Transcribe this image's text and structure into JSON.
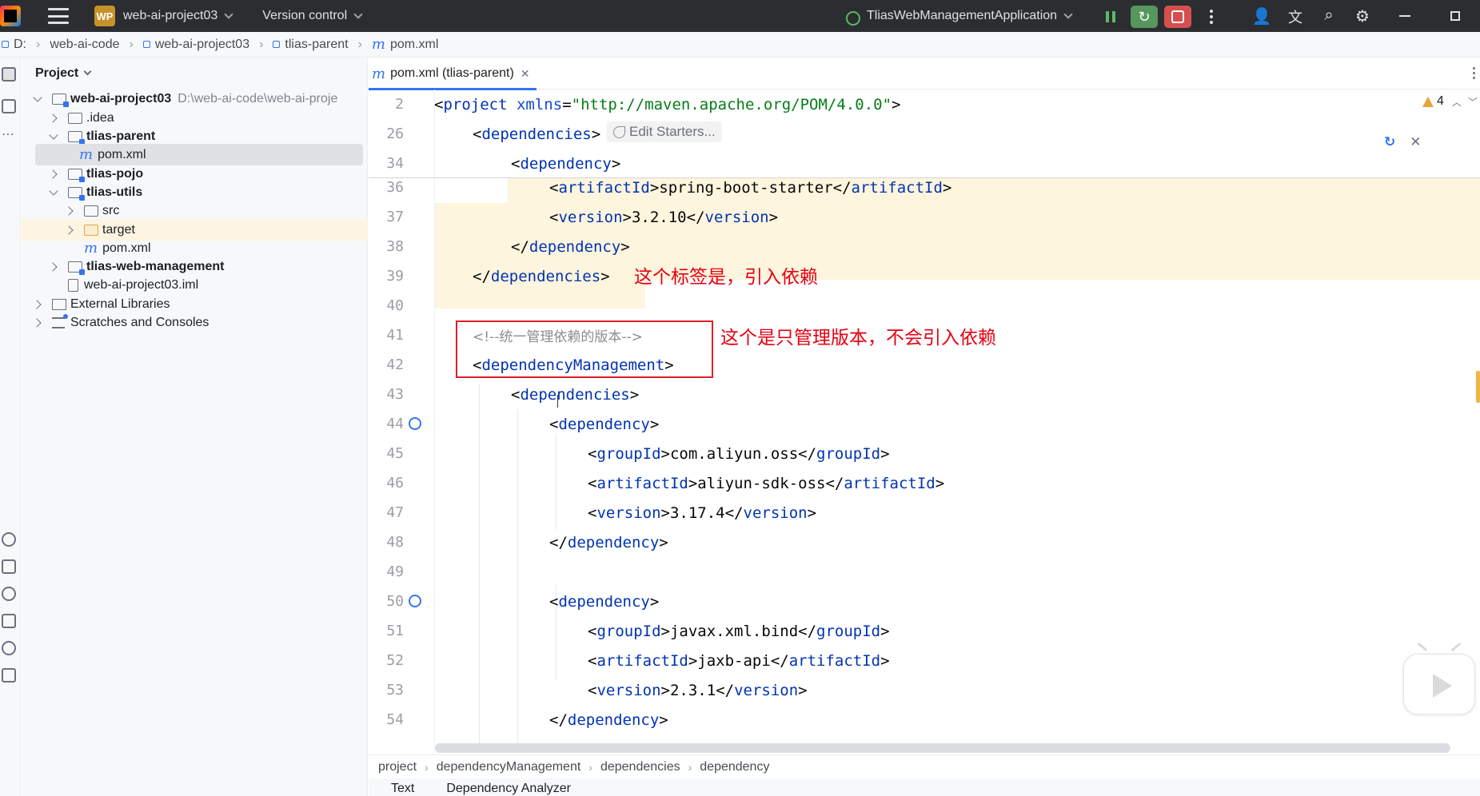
{
  "titlebar": {
    "project_badge": "WP",
    "project_name": "web-ai-project03",
    "version_control": "Version control",
    "run_config": "TliasWebManagementApplication"
  },
  "breadcrumb": [
    "D:",
    "web-ai-code",
    "web-ai-project03",
    "tlias-parent",
    "pom.xml"
  ],
  "project_panel": {
    "title": "Project",
    "tree": [
      {
        "label": "web-ai-project03",
        "hint": "D:\\web-ai-code\\web-ai-proje"
      },
      {
        "label": ".idea"
      },
      {
        "label": "tlias-parent"
      },
      {
        "label": "pom.xml"
      },
      {
        "label": "tlias-pojo"
      },
      {
        "label": "tlias-utils"
      },
      {
        "label": "src"
      },
      {
        "label": "target"
      },
      {
        "label": "pom.xml"
      },
      {
        "label": "tlias-web-management"
      },
      {
        "label": "web-ai-project03.iml"
      },
      {
        "label": "External Libraries"
      },
      {
        "label": "Scratches and Consoles"
      }
    ]
  },
  "editor": {
    "tab_label": "pom.xml (tlias-parent)",
    "warning_count": "4",
    "edit_starters": "Edit Starters...",
    "line_numbers": [
      "2",
      "26",
      "34",
      "36",
      "37",
      "38",
      "39",
      "40",
      "41",
      "42",
      "43",
      "44",
      "45",
      "46",
      "47",
      "48",
      "49",
      "50",
      "51",
      "52",
      "53",
      "54"
    ],
    "code": {
      "l2_tag": "project",
      "l2_attr": "xmlns",
      "l2_value": "\"http://maven.apache.org/POM/4.0.0\"",
      "dependencies": "dependencies",
      "dependency": "dependency",
      "artifactId": "artifactId",
      "groupId": "groupId",
      "version": "version",
      "dependencyManagement": "dependencyManagement",
      "l36_text": "spring-boot-starter",
      "l37_text": "3.2.10",
      "l41_comment": "<!--统一管理依赖的版本-->",
      "l45_text": "com.aliyun.oss",
      "l46_text": "aliyun-sdk-oss",
      "l47_text": "3.17.4",
      "l51_text": "javax.xml.bind",
      "l52_text": "jaxb-api",
      "l53_text": "2.3.1"
    }
  },
  "annotations": {
    "dependencies_note": "这个标签是，引入依赖",
    "management_note": "这个是只管理版本，不会引入依赖"
  },
  "status_crumbs": [
    "project",
    "dependencyManagement",
    "dependencies",
    "dependency"
  ],
  "bottom_tabs": [
    "Text",
    "Dependency Analyzer"
  ],
  "colors": {
    "tag": "#0033b3",
    "attr_value": "#067d17",
    "comment": "#8c8c8c",
    "annotation": "#e60012",
    "highlight": "#fdf5dd",
    "accent": "#3574f0"
  }
}
